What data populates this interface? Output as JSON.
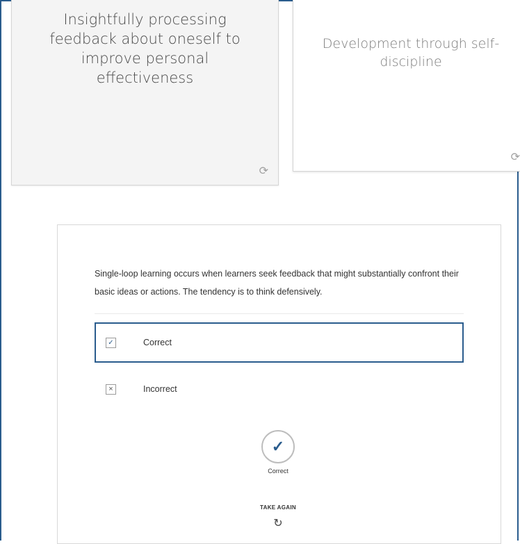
{
  "cards": [
    {
      "text": "Insightfully processing feedback about oneself to improve personal effectiveness",
      "flip_icon": "refresh-icon"
    },
    {
      "text": "Development through self-discipline",
      "flip_icon": "refresh-icon"
    }
  ],
  "quiz": {
    "question": "Single-loop learning occurs when learners seek feedback that might substantially confront their basic ideas or actions. The tendency is to think defensively.",
    "options": [
      {
        "label": "Correct",
        "mark": "✓",
        "selected": true
      },
      {
        "label": "Incorrect",
        "mark": "×",
        "selected": false
      }
    ],
    "result": {
      "icon": "checkmark-icon",
      "label": "Correct"
    },
    "take_again": {
      "label": "TAKE AGAIN",
      "icon": "retry-icon"
    },
    "accent_color": "#2a5c8d"
  }
}
